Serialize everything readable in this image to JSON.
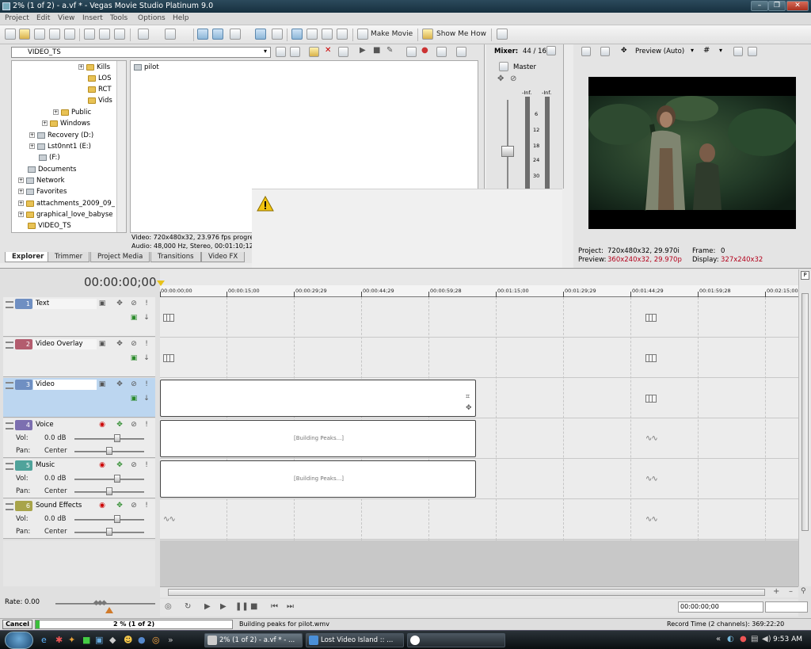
{
  "window": {
    "title": "2% (1 of 2) - a.vf * - Vegas Movie Studio Platinum 9.0"
  },
  "menu": [
    "Project",
    "Edit",
    "View",
    "Insert",
    "Tools",
    "Options",
    "Help"
  ],
  "toolbar": {
    "make_movie": "Make Movie",
    "show_me_how": "Show Me How"
  },
  "explorer": {
    "path": "VIDEO_TS",
    "tree": [
      "Kills",
      "LOS",
      "RCT",
      "Vids",
      "Public",
      "Windows",
      "Recovery (D:)",
      "Lst0nnt1 (E:)",
      "(F:)",
      "Documents",
      "Network",
      "Favorites",
      "attachments_2009_09_",
      "graphical_love_babyse",
      "VIDEO_TS"
    ],
    "files": [
      "pilot"
    ],
    "info_video": "Video: 720x480x32, 23.976 fps progress",
    "info_audio": "Audio: 48,000 Hz, Stereo, 00:01:10;12, I",
    "tabs": [
      "Explorer",
      "Trimmer",
      "Project Media",
      "Transitions",
      "Video FX"
    ]
  },
  "mixer": {
    "title": "Mixer:",
    "count": "44 / 16",
    "master": "Master",
    "meter_labels": [
      "-Inf.",
      "-Inf.",
      "6",
      "12",
      "18",
      "24",
      "30"
    ]
  },
  "preview": {
    "mode": "Preview (Auto)",
    "project_label": "Project:",
    "project_value": "720x480x32, 29.970i",
    "preview_label": "Preview:",
    "preview_value": "360x240x32, 29.970p",
    "frame_label": "Frame:",
    "frame_value": "0",
    "display_label": "Display:",
    "display_value": "327x240x32"
  },
  "timeline": {
    "current_time": "00:00:00;00",
    "ruler": [
      "00:00:00;00",
      "00:00:15;00",
      "00:00:29;29",
      "00:00:44;29",
      "00:00:59;28",
      "00:01:15;00",
      "00:01:29;29",
      "00:01:44;29",
      "00:01:59;28",
      "00:02:15;00"
    ],
    "building_peaks": "[Building Peaks...]",
    "rate": "Rate: 0.00",
    "time_box": "00:00:00;00"
  },
  "tracks": [
    {
      "num": "1",
      "name": "Text",
      "color": "#6f8fc2"
    },
    {
      "num": "2",
      "name": "Video Overlay",
      "color": "#b35c6e"
    },
    {
      "num": "3",
      "name": "Video",
      "color": "#6f8fc2"
    },
    {
      "num": "4",
      "name": "Voice",
      "color": "#7c6fb0",
      "vol_label": "Vol:",
      "vol": "0.0 dB",
      "pan_label": "Pan:",
      "pan": "Center"
    },
    {
      "num": "5",
      "name": "Music",
      "color": "#4fa39b",
      "vol_label": "Vol:",
      "vol": "0.0 dB",
      "pan_label": "Pan:",
      "pan": "Center"
    },
    {
      "num": "6",
      "name": "Sound Effects",
      "color": "#a8a44a",
      "vol_label": "Vol:",
      "vol": "0.0 dB",
      "pan_label": "Pan:",
      "pan": "Center"
    }
  ],
  "status": {
    "cancel": "Cancel",
    "progress": "2 % (1 of 2)",
    "progress_fraction": 0.02,
    "message": "Building peaks for pilot.wmv",
    "record_time": "Record Time (2 channels): 369:22:20"
  },
  "taskbar": {
    "tasks": [
      "2% (1 of 2) - a.vf * - ...",
      "Lost Video Island :: ...",
      ""
    ],
    "clock": "9:53 AM"
  },
  "colors": {
    "accent": "#1f5a8a",
    "titlebar": "#1e3a4a",
    "track_selected": "#bcd6f0",
    "preview_red": "#b3001b"
  }
}
